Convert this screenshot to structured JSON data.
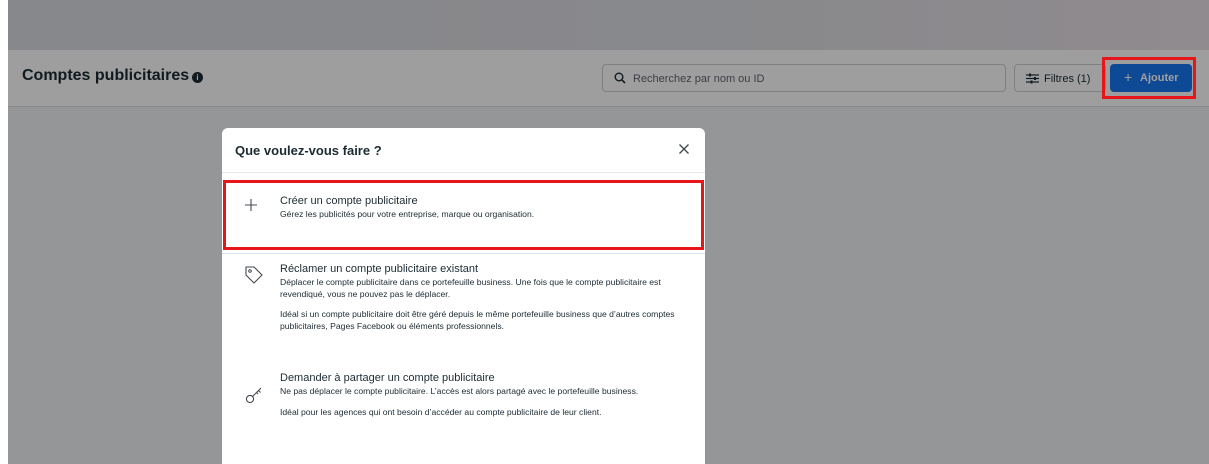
{
  "header": {
    "title": "Comptes publicitaires",
    "info_icon": "i",
    "search_placeholder": "Recherchez par nom ou ID",
    "filters_label": "Filtres (1)",
    "add_label": "Ajouter",
    "add_plus": "+"
  },
  "modal": {
    "title": "Que voulez-vous faire ?",
    "options": [
      {
        "icon": "plus-icon",
        "title": "Créer un compte publicitaire",
        "description": "Gérez les publicités pour votre entreprise, marque ou organisation."
      },
      {
        "icon": "tag-icon",
        "title": "Réclamer un compte publicitaire existant",
        "description": "Déplacer le compte publicitaire dans ce portefeuille business. Une fois que le compte publicitaire est revendiqué, vous ne pouvez pas le déplacer.",
        "extra": "Idéal si un compte publicitaire doit être géré depuis le même portefeuille business que d’autres comptes publicitaires, Pages Facebook ou éléments professionnels."
      },
      {
        "icon": "key-icon",
        "title": "Demander à partager un compte publicitaire",
        "description": "Ne pas déplacer le compte publicitaire. L’accès est alors partagé avec le portefeuille business.",
        "extra": "Idéal pour les agences qui ont besoin d’accéder au compte publicitaire de leur client."
      }
    ]
  },
  "colors": {
    "primary": "#1877f2",
    "highlight": "#e8141b",
    "text": "#1c2b33"
  }
}
